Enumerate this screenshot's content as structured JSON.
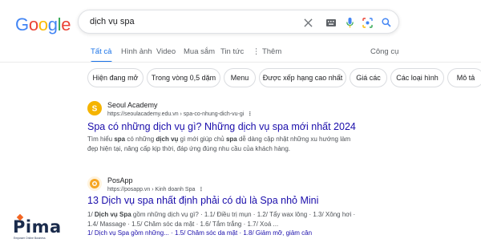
{
  "header": {
    "logo_letters": [
      "G",
      "o",
      "o",
      "g",
      "l",
      "e"
    ],
    "logo_colors": [
      "#4285f4",
      "#ea4335",
      "#fbbc05",
      "#4285f4",
      "#34a853",
      "#ea4335"
    ],
    "search_value": "dịch vụ spa",
    "icons": [
      "close-icon",
      "keyboard-icon",
      "microphone-icon",
      "lens-icon",
      "search-icon"
    ]
  },
  "tabs": {
    "items": [
      "Tất cả",
      "Hình ảnh",
      "Video",
      "Mua sắm",
      "Tin tức",
      "⋮ Thêm"
    ],
    "tools": "Công cụ"
  },
  "chips": [
    "Hiện đang mở",
    "Trong vòng 0,5 dặm",
    "Menu",
    "Được xếp hạng cao nhất",
    "Giá các",
    "Các loại hình",
    "Mô tả"
  ],
  "results": [
    {
      "site_name": "Seoul Academy",
      "url": "https://seoulacademy.edu.vn › spa-co-nhung-dich-vu-gi",
      "title": "Spa có những dịch vụ gì? Những dịch vụ spa mới nhất 2024",
      "snippet_line1_a": "Tìm hiểu ",
      "snippet_line1_b": "spa",
      "snippet_line1_c": " có những ",
      "snippet_line1_d": "dịch vụ",
      "snippet_line1_e": " gì mới giúp chủ ",
      "snippet_line1_f": "spa",
      "snippet_line1_g": " dễ dàng cập nhật những xu hướng làm",
      "snippet_line2": "đẹp hiện tại, nâng cấp kịp thời, đáp ứng đúng nhu cầu của khách hàng.",
      "favicon_color": "#f5b400"
    },
    {
      "site_name": "PosApp",
      "url": "https://posapp.vn › Kinh doanh Spa",
      "title": "13 Dịch vụ spa nhất định phải có dù là Spa nhỏ Mini",
      "line1_a": "1/ ",
      "line1_b": "Dịch vụ Spa",
      "line1_c": " gồm những dịch vụ gì? · 1.1/ Điều trị mụn · 1.2/ Tẩy wax lông · 1.3/ Xông hơi ·",
      "line2": "1.4/ Massage · 1.5/ Chăm sóc da mặt · 1.6/ Tắm trắng · 1.7/ Xoá ...",
      "links": "1/ Dịch vụ Spa gồm những... · 1.5/ Chăm sóc da mặt · 1.8/ Giảm mỡ, giảm cân",
      "favicon_color": "#f6a623"
    }
  ],
  "brand": {
    "name": "Pima",
    "tagline": "Empower Online Business",
    "accent": "#f26522",
    "color": "#1a2b4c"
  }
}
